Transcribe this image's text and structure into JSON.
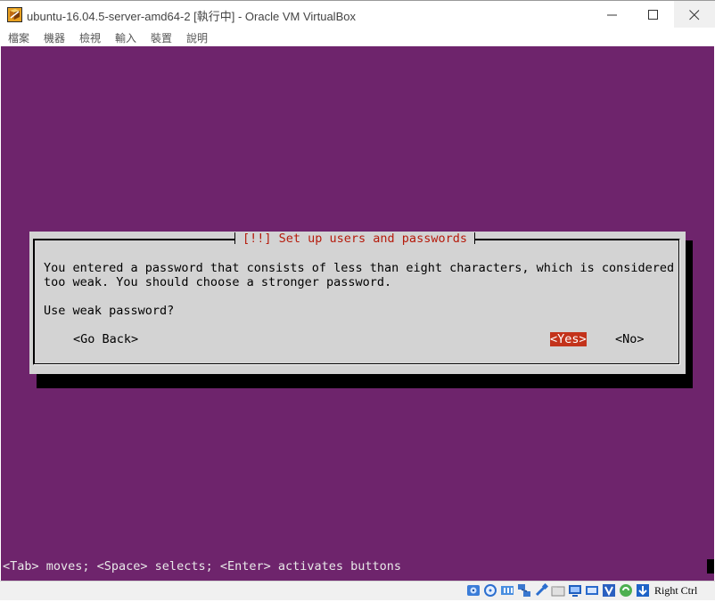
{
  "window": {
    "title": "ubuntu-16.04.5-server-amd64-2 [執行中] - Oracle VM VirtualBox"
  },
  "menu": {
    "items": [
      "檔案",
      "機器",
      "檢視",
      "輸入",
      "裝置",
      "說明"
    ]
  },
  "dialog": {
    "title": "[!!] Set up users and passwords",
    "message_line1": "You entered a password that consists of less than eight characters, which is considered",
    "message_line2": "too weak. You should choose a stronger password.",
    "question": "Use weak password?",
    "go_back_label": "<Go Back>",
    "yes_label": "<Yes>",
    "no_label": "<No>",
    "selected_option": "<Yes>"
  },
  "hint": "<Tab> moves; <Space> selects; <Enter> activates buttons",
  "statusbar": {
    "host_key": "Right Ctrl",
    "icons": [
      "hard-disk-icon",
      "optical-drive-icon",
      "audio-icon",
      "network-icon",
      "usb-icon",
      "shared-folders-icon",
      "display-icon",
      "video-capture-icon",
      "virtualization-icon",
      "mouse-integration-icon",
      "keyboard-capture-icon"
    ]
  },
  "colors": {
    "vm_background": "#6e246c",
    "dialog_background": "#d3d3d3",
    "dialog_title": "#b51b0c",
    "selected_button": "#c3331b"
  }
}
